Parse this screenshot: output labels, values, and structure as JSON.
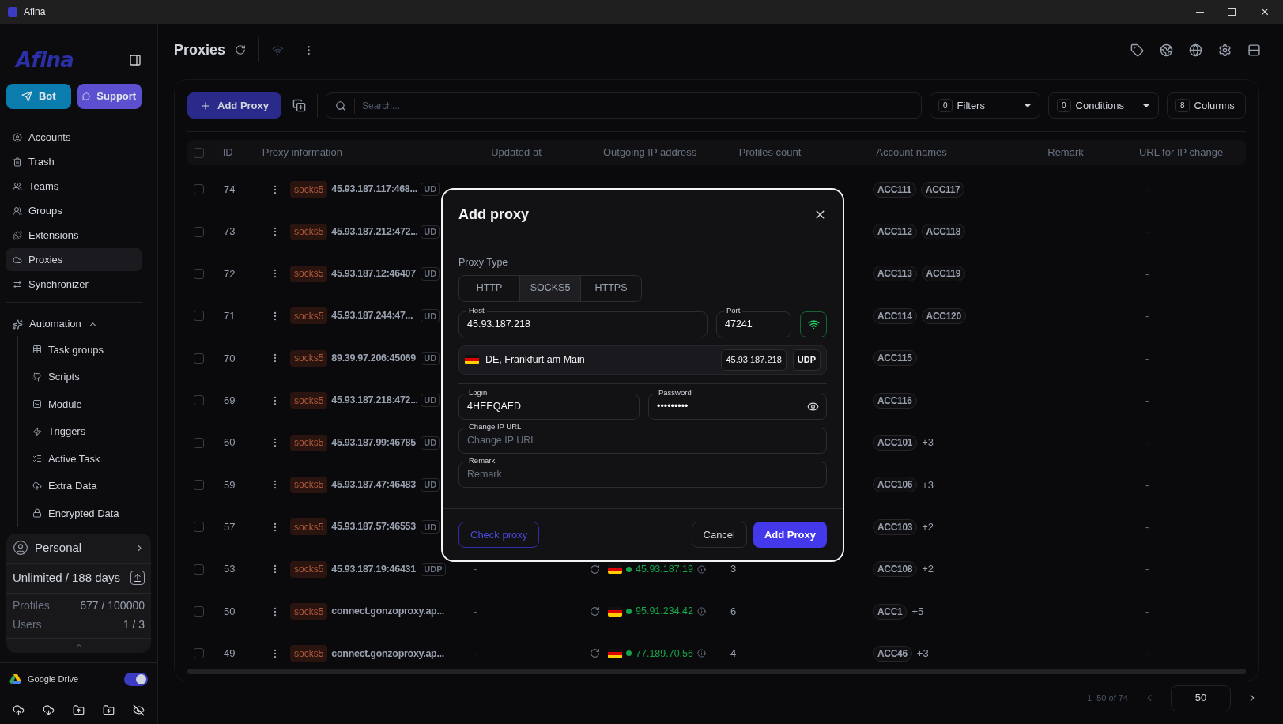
{
  "window": {
    "title": "Afina"
  },
  "sidebar": {
    "logo": "Afina",
    "buttons": [
      {
        "label": "Bot",
        "kind": "telegram"
      },
      {
        "label": "Support",
        "kind": "discord"
      }
    ],
    "items": [
      {
        "label": "Accounts",
        "selected": false
      },
      {
        "label": "Trash",
        "selected": false
      },
      {
        "label": "Teams",
        "selected": false
      },
      {
        "label": "Groups",
        "selected": false
      },
      {
        "label": "Extensions",
        "selected": false
      },
      {
        "label": "Proxies",
        "selected": true
      },
      {
        "label": "Synchronizer",
        "selected": false
      }
    ],
    "automation": {
      "label": "Automation",
      "expanded": true,
      "children": [
        {
          "label": "Task groups",
          "selected": false
        },
        {
          "label": "Scripts",
          "selected": false
        },
        {
          "label": "Module",
          "selected": false
        },
        {
          "label": "Triggers",
          "selected": false
        },
        {
          "label": "Active Task",
          "selected": false
        },
        {
          "label": "Extra Data",
          "selected": false
        },
        {
          "label": "Encrypted Data",
          "selected": false
        }
      ]
    },
    "plan": {
      "name": "Personal",
      "limit": "Unlimited / 188 days",
      "stats": [
        {
          "label": "Profiles",
          "value": "677 / 100000"
        },
        {
          "label": "Users",
          "value": "1 / 3"
        }
      ]
    },
    "google_drive": {
      "label": "Google Drive",
      "on": true
    }
  },
  "header": {
    "title": "Proxies"
  },
  "toolbar": {
    "add_button": "Add Proxy",
    "search": {
      "placeholder": "Search..."
    },
    "controls": [
      {
        "count": "0",
        "label": "Filters",
        "kind": "dropdown"
      },
      {
        "count": "0",
        "label": "Conditions",
        "kind": "dropdown"
      },
      {
        "count": "8",
        "label": "Columns",
        "kind": "button"
      }
    ]
  },
  "table": {
    "select_all_checked": false,
    "columns": [
      "ID",
      "Proxy information",
      "Updated at",
      "Outgoing IP address",
      "Profiles count",
      "Account names",
      "Remark",
      "URL for IP change"
    ],
    "rows": [
      {
        "checked": false,
        "id": "74",
        "type": "socks5",
        "address": "45.93.187.117:468...",
        "udp": "UD",
        "accounts": [
          "ACC111",
          "ACC117"
        ],
        "url": "-"
      },
      {
        "checked": false,
        "id": "73",
        "type": "socks5",
        "address": "45.93.187.212:472...",
        "udp": "UD",
        "accounts": [
          "ACC112",
          "ACC118"
        ],
        "url": "-"
      },
      {
        "checked": false,
        "id": "72",
        "type": "socks5",
        "address": "45.93.187.12:46407",
        "udp": "UD",
        "accounts": [
          "ACC113",
          "ACC119"
        ],
        "url": "-"
      },
      {
        "checked": false,
        "id": "71",
        "type": "socks5",
        "address": "45.93.187.244:47...",
        "udp": "UD",
        "accounts": [
          "ACC114",
          "ACC120"
        ],
        "url": "-"
      },
      {
        "checked": false,
        "id": "70",
        "type": "socks5",
        "address": "89.39.97.206:45069",
        "udp": "UD",
        "accounts": [
          "ACC115"
        ],
        "url": "-"
      },
      {
        "checked": false,
        "id": "69",
        "type": "socks5",
        "address": "45.93.187.218:472...",
        "udp": "UD",
        "accounts": [
          "ACC116"
        ],
        "url": "-"
      },
      {
        "checked": false,
        "id": "60",
        "type": "socks5",
        "address": "45.93.187.99:46785",
        "udp": "UD",
        "accounts": [
          "ACC101"
        ],
        "more": "+3",
        "url": "-"
      },
      {
        "checked": false,
        "id": "59",
        "type": "socks5",
        "address": "45.93.187.47:46483",
        "udp": "UD",
        "accounts": [
          "ACC106"
        ],
        "more": "+3",
        "url": "-"
      },
      {
        "checked": false,
        "id": "57",
        "type": "socks5",
        "address": "45.93.187.57:46553",
        "udp": "UD",
        "accounts": [
          "ACC103"
        ],
        "more": "+2",
        "url": "-"
      },
      {
        "checked": false,
        "id": "53",
        "type": "socks5",
        "address": "45.93.187.19:46431",
        "udp": "UDP",
        "updated": "-",
        "outgoing": {
          "ip": "45.93.187.19",
          "color": "#16a34a"
        },
        "profiles": "3",
        "accounts": [
          "ACC108"
        ],
        "more": "+2",
        "url": "-"
      },
      {
        "checked": false,
        "id": "50",
        "type": "socks5",
        "address": "connect.gonzoproxy.ap...",
        "updated": "-",
        "outgoing": {
          "ip": "95.91.234.42",
          "color": "#16a34a"
        },
        "profiles": "6",
        "accounts": [
          "ACC1"
        ],
        "more": "+5",
        "url": "-"
      },
      {
        "checked": false,
        "id": "49",
        "type": "socks5",
        "address": "connect.gonzoproxy.ap...",
        "updated": "-",
        "outgoing": {
          "ip": "77.189.70.56",
          "color": "#16a34a"
        },
        "profiles": "4",
        "accounts": [
          "ACC46"
        ],
        "more": "+3",
        "url": "-"
      }
    ]
  },
  "pagination": {
    "range": "1–50 of 74",
    "page_size": "50"
  },
  "modal": {
    "title": "Add proxy",
    "type_label": "Proxy Type",
    "types": [
      {
        "label": "HTTP",
        "selected": false
      },
      {
        "label": "SOCKS5",
        "selected": true
      },
      {
        "label": "HTTPS",
        "selected": false
      }
    ],
    "host": {
      "label": "Host",
      "value": "45.93.187.218"
    },
    "port": {
      "label": "Port",
      "value": "47241"
    },
    "check_ok": true,
    "location": "DE, Frankfurt am Main",
    "ip": "45.93.187.218",
    "protocol": "UDP",
    "login": {
      "label": "Login",
      "value": "4HEEQAED"
    },
    "password": {
      "label": "Password",
      "value": "•••••••••"
    },
    "change_ip": {
      "label": "Change IP URL",
      "placeholder": "Change IP URL"
    },
    "remark": {
      "label": "Remark",
      "placeholder": "Remark"
    },
    "buttons": {
      "check": "Check proxy",
      "cancel": "Cancel",
      "submit": "Add Proxy"
    }
  }
}
